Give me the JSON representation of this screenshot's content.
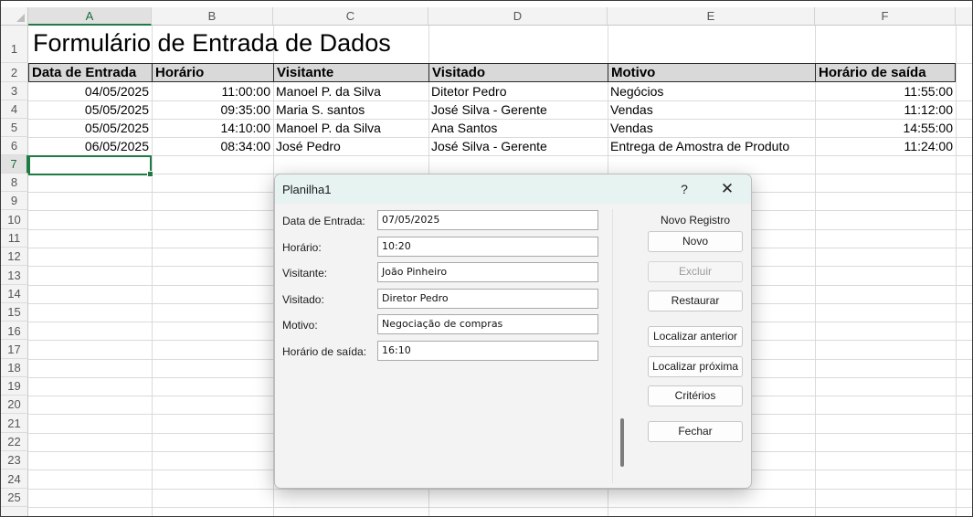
{
  "columns": [
    "A",
    "B",
    "C",
    "D",
    "E",
    "F"
  ],
  "rows": [
    "1",
    "2",
    "3",
    "4",
    "5",
    "6",
    "7",
    "8",
    "9",
    "10",
    "11",
    "12",
    "13",
    "14",
    "15",
    "16",
    "17",
    "18",
    "19",
    "20",
    "21",
    "22",
    "23",
    "24",
    "25"
  ],
  "sheet": {
    "title": "Formulário de Entrada de Dados",
    "headers": [
      "Data de Entrada",
      "Horário",
      "Visitante",
      "Visitado",
      "Motivo",
      "Horário de saída"
    ],
    "data": [
      [
        "04/05/2025",
        "11:00:00",
        "Manoel P. da Silva",
        "Ditetor Pedro",
        "Negócios",
        "11:55:00"
      ],
      [
        "05/05/2025",
        "09:35:00",
        "Maria S. santos",
        "José Silva - Gerente",
        "Vendas",
        "11:12:00"
      ],
      [
        "05/05/2025",
        "14:10:00",
        "Manoel P. da Silva",
        "Ana Santos",
        "Vendas",
        "14:55:00"
      ],
      [
        "06/05/2025",
        "08:34:00",
        "José Pedro",
        "José Silva - Gerente",
        "Entrega de Amostra de Produto",
        "11:24:00"
      ]
    ]
  },
  "dialog": {
    "title": "Planilha1",
    "help": "?",
    "close": "✕",
    "record_label": "Novo Registro",
    "fields": [
      {
        "label": "Data de Entrada:",
        "value": "07/05/2025"
      },
      {
        "label": "Horário:",
        "value": "10:20"
      },
      {
        "label": "Visitante:",
        "value": "João Pinheiro"
      },
      {
        "label": "Visitado:",
        "value": "Diretor Pedro"
      },
      {
        "label": "Motivo:",
        "value": "Negociação de compras"
      },
      {
        "label": "Horário de saída:",
        "value": "16:10"
      }
    ],
    "buttons": {
      "novo": "Novo",
      "excluir": "Excluir",
      "restaurar": "Restaurar",
      "localizar_anterior": "Localizar anterior",
      "localizar_proxima": "Localizar próxima",
      "criterios": "Critérios",
      "fechar": "Fechar"
    }
  }
}
